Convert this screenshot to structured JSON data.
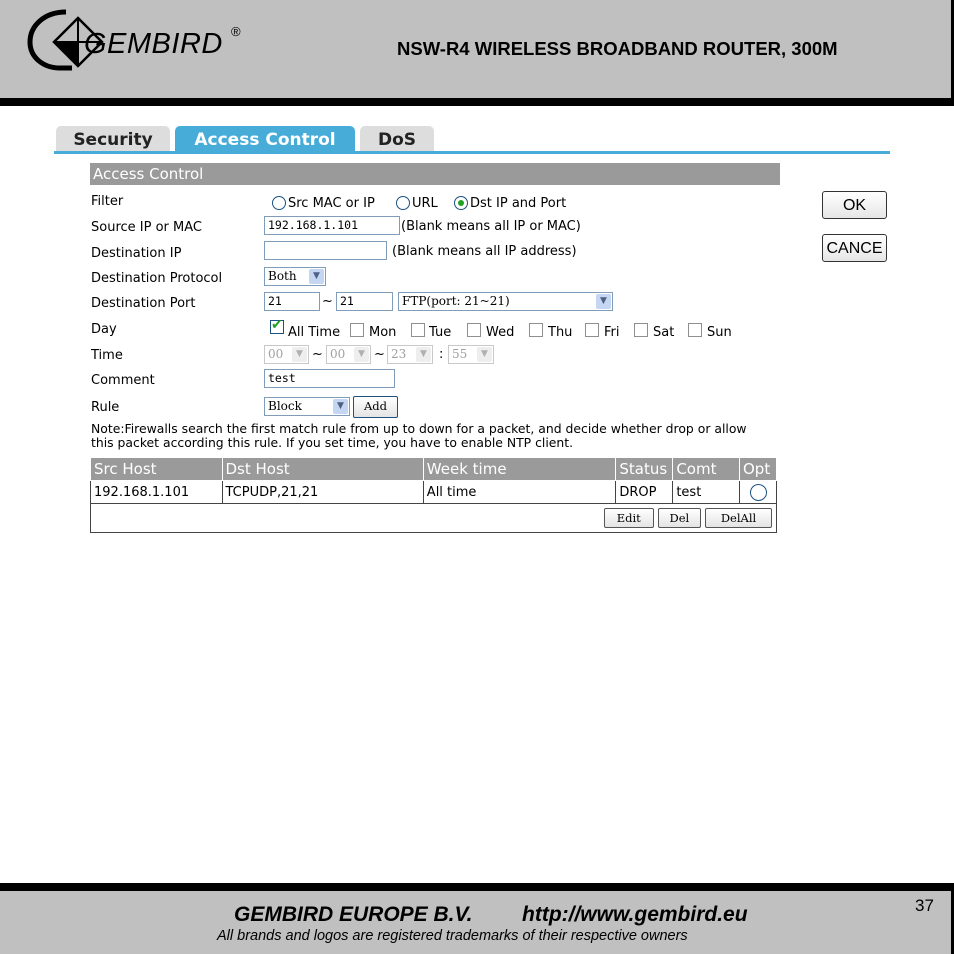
{
  "header": {
    "brand": "GEMBIRD",
    "registered": "®",
    "title": "NSW-R4 WIRELESS BROADBAND ROUTER, 300M"
  },
  "tabs": [
    {
      "label": "Security",
      "active": false
    },
    {
      "label": "Access Control",
      "active": true
    },
    {
      "label": "DoS",
      "active": false
    }
  ],
  "form": {
    "section_title": "Access Control",
    "filter": {
      "label": "Filter",
      "options": [
        {
          "label": "Src MAC or IP",
          "selected": false
        },
        {
          "label": "URL",
          "selected": false
        },
        {
          "label": "Dst IP and Port",
          "selected": true
        }
      ]
    },
    "source": {
      "label": "Source IP or MAC",
      "value": "192.168.1.101",
      "hint": "(Blank means all IP or MAC)"
    },
    "destination_ip": {
      "label": "Destination IP",
      "value": "",
      "hint": "(Blank means all IP address)"
    },
    "protocol": {
      "label": "Destination Protocol",
      "value": "Both"
    },
    "port": {
      "label": "Destination Port",
      "from": "21",
      "sep": "~",
      "to": "21",
      "service": "FTP(port: 21~21)"
    },
    "day": {
      "label": "Day",
      "options": [
        {
          "label": "All Time",
          "checked": true
        },
        {
          "label": "Mon",
          "checked": false
        },
        {
          "label": "Tue",
          "checked": false
        },
        {
          "label": "Wed",
          "checked": false
        },
        {
          "label": "Thu",
          "checked": false
        },
        {
          "label": "Fri",
          "checked": false
        },
        {
          "label": "Sat",
          "checked": false
        },
        {
          "label": "Sun",
          "checked": false
        }
      ]
    },
    "time": {
      "label": "Time",
      "start_hour": "00",
      "start_min": "00",
      "end_hour": "23",
      "end_min": "55",
      "sep1": "~",
      "sep2": "~",
      "sep3": ":"
    },
    "comment": {
      "label": "Comment",
      "value": "test"
    },
    "rule": {
      "label": "Rule",
      "value": "Block",
      "add_label": "Add"
    },
    "note": "Note:Firewalls search the first match rule from up to down for a packet, and decide whether drop or allow this packet according this rule. If you set time, you have to enable NTP client."
  },
  "side_buttons": {
    "ok": "OK",
    "cancel": "CANCE"
  },
  "table": {
    "headers": [
      "Src Host",
      "Dst Host",
      "Week time",
      "Status",
      "Comt",
      "Opt"
    ],
    "rows": [
      {
        "src": "192.168.1.101",
        "dst": "TCPUDP,21,21",
        "week": "All time",
        "status": "DROP",
        "comt": "test"
      }
    ],
    "actions": {
      "edit": "Edit",
      "del": "Del",
      "delall": "DelAll"
    }
  },
  "footer": {
    "company": "GEMBIRD EUROPE B.V.",
    "url": "http://www.gembird.eu",
    "note": "All brands and logos are registered trademarks of their respective owners",
    "page": "37"
  }
}
